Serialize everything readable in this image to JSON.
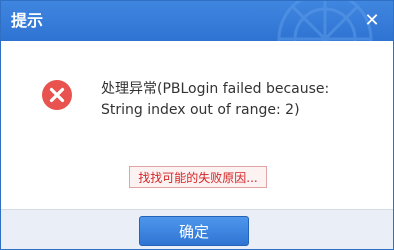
{
  "dialog": {
    "title": "提示",
    "close_icon": "close-icon",
    "icon": "error-circle-icon",
    "message_line1": "处理异常(PBLogin failed because:",
    "message_line2": "String index out of range: 2)",
    "find_link_label": "找找可能的失败原因...",
    "ok_label": "确定"
  },
  "colors": {
    "titlebar": "#3a7ede",
    "error_icon": "#e8534f",
    "link_text": "#d42424",
    "button": "#3a83e0"
  }
}
